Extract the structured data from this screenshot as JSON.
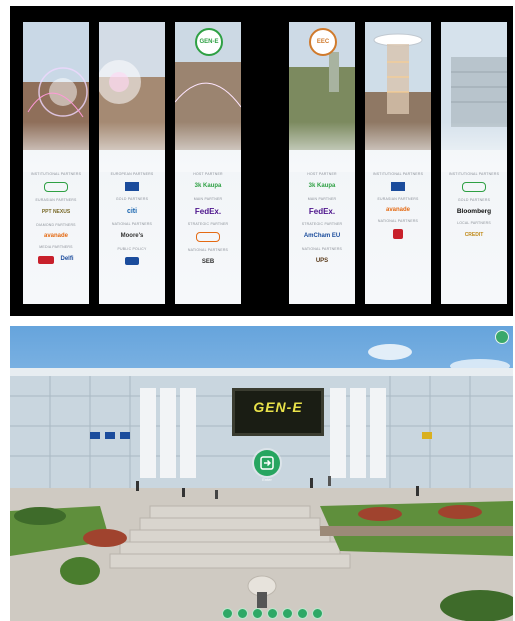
{
  "banners": {
    "b1": {
      "sections": [
        {
          "category": "Institutional partners",
          "logo": ""
        },
        {
          "category": "Eurasian partners",
          "logo": "PPT NEXUS"
        },
        {
          "category": "Diamond partners",
          "logo": "avanade"
        },
        {
          "category": "Media partners",
          "logo": "Delfi"
        }
      ]
    },
    "b2": {
      "sections": [
        {
          "category": "European partners",
          "logo": ""
        },
        {
          "category": "Gold partners",
          "logo": "citi"
        },
        {
          "category": "National partners",
          "logo": "Moore's"
        },
        {
          "category": "Public policy",
          "logo": ""
        }
      ]
    },
    "b3": {
      "badge": "GEN-E",
      "sections": [
        {
          "category": "Host partner",
          "logo": "3k Kaupa"
        },
        {
          "category": "Main partner",
          "logo": "FedEx."
        },
        {
          "category": "Strategic partner",
          "logo": ""
        },
        {
          "category": "National partners",
          "logo": "SEB"
        }
      ]
    },
    "b4": {
      "badge": "EEC",
      "sections": [
        {
          "category": "Host partner",
          "logo": "3k Kaupa"
        },
        {
          "category": "Main partner",
          "logo": "FedEx."
        },
        {
          "category": "Strategic partner",
          "logo": "AmCham EU"
        },
        {
          "category": "National partners",
          "logo": "UPS"
        }
      ]
    },
    "b5": {
      "sections": [
        {
          "category": "Institutional partners",
          "logo": ""
        },
        {
          "category": "Eurasian partners",
          "logo": "avanade"
        },
        {
          "category": "National partners",
          "logo": ""
        }
      ]
    },
    "b6": {
      "sections": [
        {
          "category": "Institutional partners",
          "logo": ""
        },
        {
          "category": "Gold partners",
          "logo": "Bloomberg"
        },
        {
          "category": "Local partners",
          "logo": "CREDIT"
        }
      ]
    }
  },
  "scene": {
    "screen_title": "GEN-E",
    "enter_label": "Enter"
  },
  "colors": {
    "accent_green": "#27a560",
    "sky": "#66a4dc"
  }
}
